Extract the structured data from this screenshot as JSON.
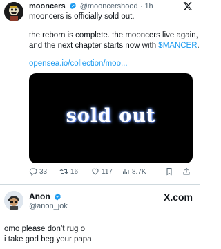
{
  "tweet": {
    "display_name": "mooncers",
    "handle": "@mooncershood",
    "separator": "·",
    "time": "1h",
    "line1": "mooncers is officially sold out.",
    "line2": "the reborn is complete. the mooncers live again,",
    "line3_prefix": "and the next chapter starts now with ",
    "cashtag": "$MANCER",
    "line3_suffix": ".",
    "link": "opensea.io/collection/moo...",
    "media_text": "sold out",
    "stats": {
      "replies": "33",
      "retweets": "16",
      "likes": "117",
      "views": "8.7K"
    },
    "icons": [
      "verified-icon",
      "x-logo-icon",
      "reply-icon",
      "retweet-icon",
      "like-icon",
      "views-icon",
      "bookmark-icon",
      "share-icon"
    ],
    "colors": {
      "accent": "#1d9bf0",
      "muted": "#536471",
      "text": "#0f1419"
    }
  },
  "reply": {
    "display_name": "Anon",
    "handle": "@anon_jok",
    "brand": "X.com",
    "line1": "omo please don’t rug o",
    "line2": "i take god beg your papa"
  }
}
